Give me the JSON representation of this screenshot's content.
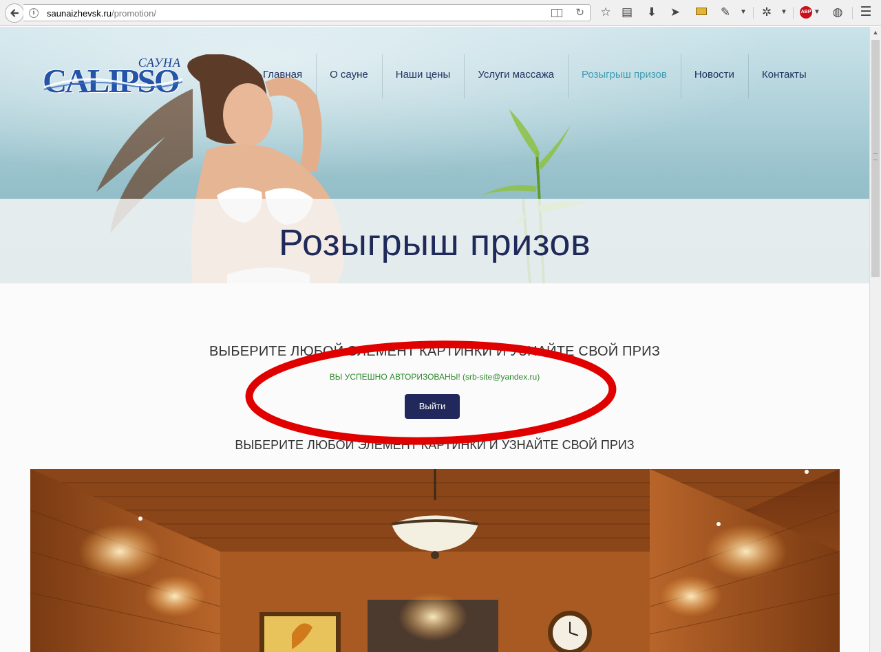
{
  "browser": {
    "url_host": "saunaizhevsk.ru",
    "url_path": "/promotion/",
    "abp_label": "ABP"
  },
  "site": {
    "logo_small": "САУНА",
    "logo_main": "CALIPSO",
    "nav": [
      {
        "label": "Главная",
        "active": false
      },
      {
        "label": "О сауне",
        "active": false
      },
      {
        "label": "Наши цены",
        "active": false
      },
      {
        "label": "Услуги массажа",
        "active": false
      },
      {
        "label": "Розыгрыш призов",
        "active": true
      },
      {
        "label": "Новости",
        "active": false
      },
      {
        "label": "Контакты",
        "active": false
      }
    ],
    "page_title": "Розыгрыш призов"
  },
  "promo": {
    "heading_top": "ВЫБЕРИТЕ ЛЮБОЙ ЭЛЕМЕНТ КАРТИНКИ И УЗНАЙТЕ СВОЙ ПРИЗ",
    "auth_message": "ВЫ УСПЕШНО АВТОРИЗОВАНЫ! (srb-site@yandex.ru)",
    "logout_label": "Выйти",
    "heading_bottom": "ВЫБЕРИТЕ ЛЮБОЙ ЭЛЕМЕНТ КАРТИНКИ И УЗНАЙТЕ СВОЙ ПРИЗ"
  },
  "colors": {
    "accent": "#3b9bb0",
    "nav_text": "#1f2f5e",
    "button_bg": "#20285c",
    "success_text": "#2d8a2d",
    "annotation": "#e00000"
  },
  "icons": {
    "toolbar": [
      "bookmark-star-icon",
      "reading-list-icon",
      "download-icon",
      "send-icon",
      "ruler-icon",
      "eyedropper-icon",
      "extension-icon",
      "adblock-icon",
      "globe-icon",
      "menu-icon"
    ]
  }
}
